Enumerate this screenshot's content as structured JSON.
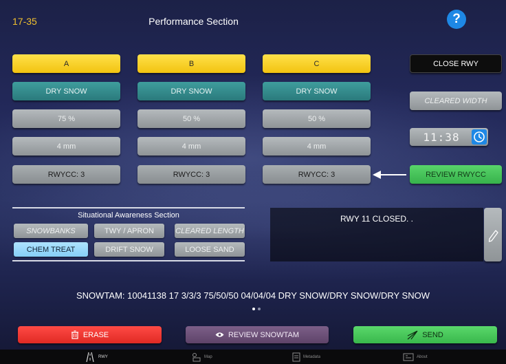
{
  "header": {
    "runway_id": "17-35",
    "title": "Performance Section",
    "help_label": "?"
  },
  "columns": [
    {
      "name": "A",
      "contaminant": "DRY SNOW",
      "coverage": "75 %",
      "depth": "4 mm",
      "rwycc": "RWYCC: 3"
    },
    {
      "name": "B",
      "contaminant": "DRY SNOW",
      "coverage": "50 %",
      "depth": "4 mm",
      "rwycc": "RWYCC: 3"
    },
    {
      "name": "C",
      "contaminant": "DRY SNOW",
      "coverage": "50 %",
      "depth": "4 mm",
      "rwycc": "RWYCC: 3"
    }
  ],
  "actions": {
    "close_rwy": "CLOSE RWY",
    "cleared_width": "CLEARED WIDTH",
    "time": "11:38",
    "review_rwycc": "REVIEW RWYCC"
  },
  "situational": {
    "title": "Situational Awareness Section",
    "buttons": [
      "SNOWBANKS",
      "TWY / APRON",
      "CLEARED LENGTH",
      "CHEM TREAT",
      "DRIFT SNOW",
      "LOOSE SAND"
    ]
  },
  "notes": {
    "text": "RWY 11 CLOSED. ."
  },
  "snowtam": {
    "text": "SNOWTAM: 10041138 17 3/3/3 75/50/50 04/04/04 DRY SNOW/DRY SNOW/DRY SNOW"
  },
  "bottom": {
    "erase": "ERASE",
    "review_snowtam": "REVIEW SNOWTAM",
    "send": "SEND"
  },
  "tabs": [
    "RWY",
    "Map",
    "Metadata",
    "About"
  ],
  "colors": {
    "accent_yellow": "#f2c12e",
    "help_blue": "#1e88e5",
    "erase_red": "#e53935",
    "send_green": "#3fbf52",
    "review_purple": "#6a4d76"
  }
}
